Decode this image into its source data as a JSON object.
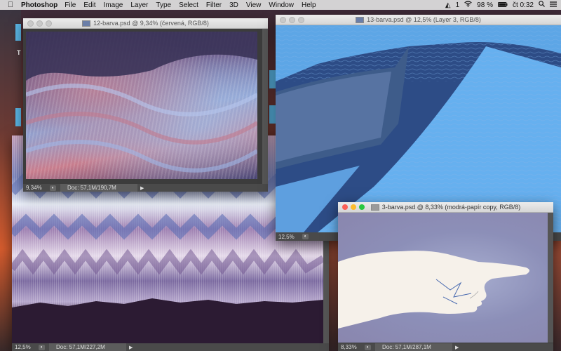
{
  "menubar": {
    "app_name": "Photoshop",
    "menus": [
      "File",
      "Edit",
      "Image",
      "Layer",
      "Type",
      "Select",
      "Filter",
      "3D",
      "View",
      "Window",
      "Help"
    ],
    "status": {
      "notification_count": "1",
      "battery": "98 %",
      "clock": "čt 0:32"
    }
  },
  "desktop": {
    "label": "T"
  },
  "windows": {
    "w12": {
      "title": "12-barva.psd @ 9,34% (červená, RGB/8)",
      "zoom": "9,34%",
      "doc": "Doc: 57,1M/190,7M"
    },
    "w13": {
      "title": "13-barva.psd @ 12,5% (Layer 3, RGB/8)",
      "zoom": "12,5%",
      "doc": ""
    },
    "wbottom": {
      "zoom": "12,5%",
      "doc": "Doc: 57,1M/227,2M"
    },
    "w3": {
      "title": "3-barva.psd @ 8,33% (modrá-papír copy, RGB/8)",
      "zoom": "8,33%",
      "doc": "Doc: 57,1M/287,1M"
    }
  }
}
